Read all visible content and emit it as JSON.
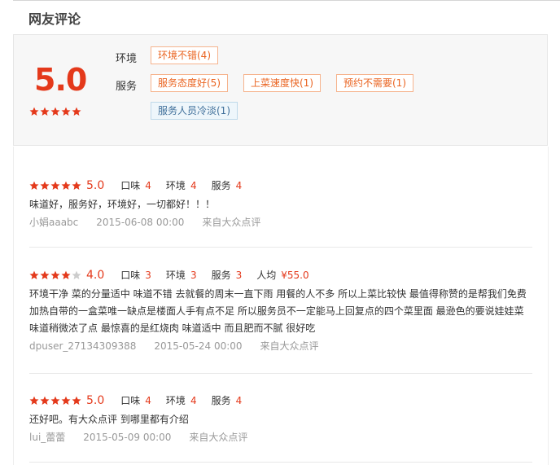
{
  "section": {
    "title": "网友评论"
  },
  "summary": {
    "score": "5.0",
    "stars": 5,
    "environment_label": "环境",
    "service_label": "服务",
    "environment_tags": [
      "环境不错(4)"
    ],
    "service_tags": [
      "服务态度好(5)",
      "上菜速度快(1)",
      "预约不需要(1)"
    ],
    "negative_tags": [
      "服务人员冷淡(1)"
    ]
  },
  "reviews": [
    {
      "stars": 5,
      "score": "5.0",
      "taste_label": "口味",
      "taste": "4",
      "env_label": "环境",
      "env": "4",
      "service_label": "服务",
      "service": "4",
      "text": "味道好，服务好，环境好，一切都好！！！",
      "user": "小娟aaabc",
      "date": "2015-06-08 00:00",
      "source": "来自大众点评"
    },
    {
      "stars": 4,
      "score": "4.0",
      "taste_label": "口味",
      "taste": "3",
      "env_label": "环境",
      "env": "3",
      "service_label": "服务",
      "service": "3",
      "price_label": "人均",
      "price": "¥55.0",
      "text_lines": [
        "环境干净 菜的分量适中 味道不错 去就餐的周末一直下雨 用餐的人不多 所以上菜比较快 最值得称赞的是帮我们免费",
        "加热自带的一盒菜唯一缺点是楼面人手有点不足 所以服务员不一定能马上回复点的四个菜里面 最逊色的要说娃娃菜",
        "味道稍微浓了点 最惊喜的是红烧肉 味道适中 而且肥而不腻 很好吃"
      ],
      "user": "dpuser_27134309388",
      "date": "2015-05-24 00:00",
      "source": "来自大众点评"
    },
    {
      "stars": 5,
      "score": "5.0",
      "taste_label": "口味",
      "taste": "4",
      "env_label": "环境",
      "env": "4",
      "service_label": "服务",
      "service": "4",
      "text": "还好吧。有大众点评 到哪里都有介绍",
      "user": "lui_蕾蕾",
      "date": "2015-05-09 00:00",
      "source": "来自大众点评"
    }
  ],
  "colors": {
    "accent": "#e4391b",
    "star_on": "#e4391b",
    "star_off": "#cccccc",
    "tag_text": "#ea6421",
    "tag_border": "#f6b48e",
    "neg_tag_text": "#3f6f9a"
  }
}
